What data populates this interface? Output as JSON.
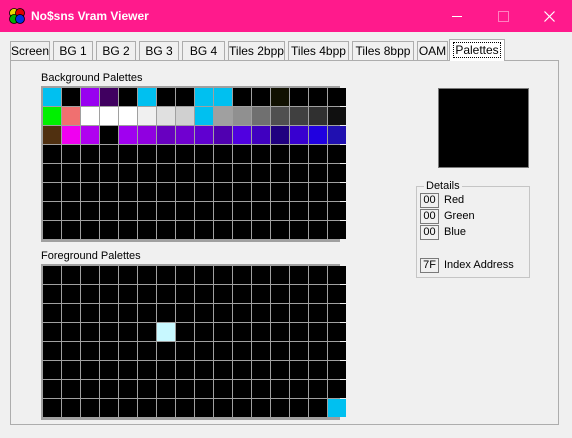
{
  "window": {
    "title": "No$sns Vram Viewer",
    "titlebar_color": "#ff1a8c",
    "icon": "no-sns-app-icon",
    "controls": [
      "minimize-icon",
      "maximize-icon",
      "close-icon"
    ]
  },
  "tabs": [
    {
      "label": "Screen"
    },
    {
      "label": "BG 1"
    },
    {
      "label": "BG 2"
    },
    {
      "label": "BG 3"
    },
    {
      "label": "BG 4"
    },
    {
      "label": "Tiles 2bpp"
    },
    {
      "label": "Tiles 4bpp"
    },
    {
      "label": "Tiles 8bpp"
    },
    {
      "label": "OAM"
    },
    {
      "label": "Palettes",
      "active": true
    }
  ],
  "background": {
    "label": "Background Palettes",
    "columns": 16,
    "rows": [
      [
        "#00c0f0",
        "#000000",
        "#9800f0",
        "#400060",
        "#000000",
        "#00c0f0",
        "#000000",
        "#000000",
        "#00c0f0",
        "#00c0f0",
        "#000000",
        "#000000",
        "#101000",
        "#000000",
        "#000000",
        "#000000"
      ],
      [
        "#00f000",
        "#f07070",
        "#ffffff",
        "#ffffff",
        "#ffffff",
        "#f0f0f0",
        "#e0e0e0",
        "#d0d0d0",
        "#00c0f0",
        "#a0a0a0",
        "#909090",
        "#707070",
        "#505050",
        "#404040",
        "#303030",
        "#101010"
      ],
      [
        "#503010",
        "#f000f0",
        "#b000f0",
        "#000000",
        "#a000f0",
        "#9000e0",
        "#6800c0",
        "#7000d0",
        "#6000d0",
        "#5000b0",
        "#5000e0",
        "#4000c0",
        "#200080",
        "#3800d0",
        "#2000e0",
        "#2010b0"
      ],
      [
        "#000000",
        "#000000",
        "#000000",
        "#000000",
        "#000000",
        "#000000",
        "#000000",
        "#000000",
        "#000000",
        "#000000",
        "#000000",
        "#000000",
        "#000000",
        "#000000",
        "#000000",
        "#000000"
      ],
      [
        "#000000",
        "#000000",
        "#000000",
        "#000000",
        "#000000",
        "#000000",
        "#000000",
        "#000000",
        "#000000",
        "#000000",
        "#000000",
        "#000000",
        "#000000",
        "#000000",
        "#000000",
        "#000000"
      ],
      [
        "#000000",
        "#000000",
        "#000000",
        "#000000",
        "#000000",
        "#000000",
        "#000000",
        "#000000",
        "#000000",
        "#000000",
        "#000000",
        "#000000",
        "#000000",
        "#000000",
        "#000000",
        "#000000"
      ],
      [
        "#000000",
        "#000000",
        "#000000",
        "#000000",
        "#000000",
        "#000000",
        "#000000",
        "#000000",
        "#000000",
        "#000000",
        "#000000",
        "#000000",
        "#000000",
        "#000000",
        "#000000",
        "#000000"
      ],
      [
        "#000000",
        "#000000",
        "#000000",
        "#000000",
        "#000000",
        "#000000",
        "#000000",
        "#000000",
        "#000000",
        "#000000",
        "#000000",
        "#000000",
        "#000000",
        "#000000",
        "#000000",
        "#000000"
      ]
    ]
  },
  "foreground": {
    "label": "Foreground Palettes",
    "columns": 16,
    "rows": 8,
    "base_color": "#000000",
    "highlights": [
      {
        "row": 3,
        "col": 6,
        "color": "#c8f8ff"
      },
      {
        "row": 7,
        "col": 15,
        "color": "#00c0f0"
      }
    ]
  },
  "preview": {
    "color": "#000000"
  },
  "details": {
    "legend": "Details",
    "red_value": "00",
    "red_label": "Red",
    "green_value": "00",
    "green_label": "Green",
    "blue_value": "00",
    "blue_label": "Blue",
    "index_value": "7F",
    "index_label": "Index Address"
  }
}
